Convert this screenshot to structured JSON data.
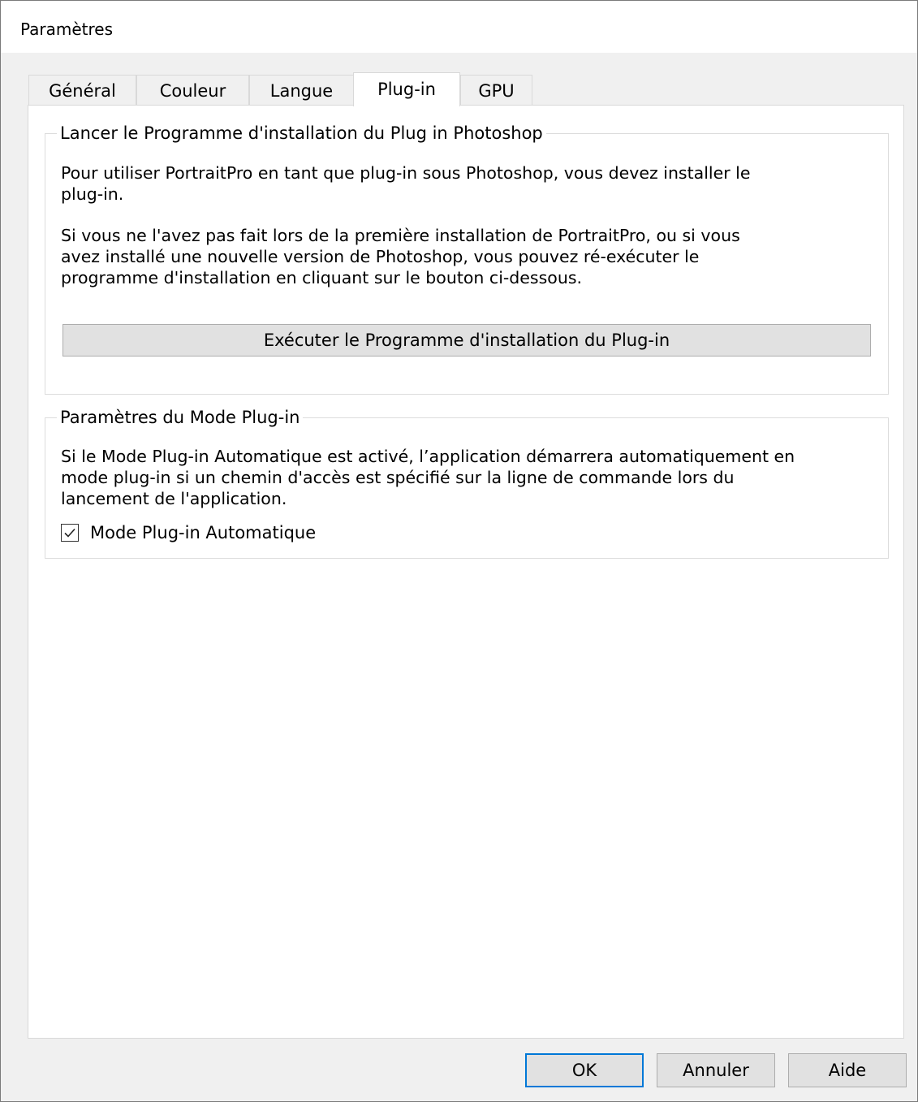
{
  "window": {
    "title": "Paramètres"
  },
  "tabs": [
    {
      "label": "Général",
      "active": false
    },
    {
      "label": "Couleur",
      "active": false
    },
    {
      "label": "Langue",
      "active": false
    },
    {
      "label": "Plug-in",
      "active": true
    },
    {
      "label": "GPU",
      "active": false
    }
  ],
  "installer_group": {
    "legend": "Lancer le Programme d'installation du Plug in Photoshop",
    "paragraph1": [
      "Pour utiliser PortraitPro en tant que plug-in sous Photoshop, vous devez installer le",
      "plug-in."
    ],
    "paragraph2": [
      "Si vous ne l'avez pas fait lors de la première installation de PortraitPro, ou si vous",
      "avez installé une nouvelle version de Photoshop, vous pouvez ré-exécuter le",
      "programme d'installation en cliquant sur le bouton ci-dessous."
    ],
    "run_button_label": "Exécuter le Programme d'installation du Plug-in"
  },
  "mode_group": {
    "legend": "Paramètres du Mode Plug-in",
    "description": [
      "Si le Mode Plug-in Automatique est activé, l’application démarrera automatiquement en",
      "mode plug-in si un chemin d'accès est spécifié sur la ligne de commande lors du",
      "lancement de l'application."
    ],
    "checkbox_label": "Mode Plug-in Automatique",
    "checkbox_checked": true
  },
  "footer": {
    "ok_label": "OK",
    "cancel_label": "Annuler",
    "help_label": "Aide"
  },
  "colors": {
    "accent": "#0078d7",
    "dialog_background": "#f0f0f0",
    "button_face": "#e1e1e1"
  },
  "icons": {
    "checkbox_mark": "checkmark-icon"
  }
}
